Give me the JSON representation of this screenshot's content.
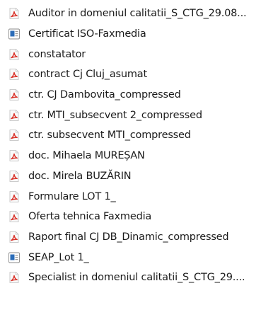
{
  "colors": {
    "pdf_icon": "#d9342b",
    "doc_icon": "#2b6cb8",
    "text": "#1b1b1b"
  },
  "files": [
    {
      "name": "Auditor in domeniul calitatii_S_CTG_29.08...",
      "icon": "pdf-icon"
    },
    {
      "name": "Certificat ISO-Faxmedia",
      "icon": "document-icon"
    },
    {
      "name": "constatator",
      "icon": "pdf-icon"
    },
    {
      "name": "contract Cj Cluj_asumat",
      "icon": "pdf-icon"
    },
    {
      "name": "ctr. CJ Dambovita_compressed",
      "icon": "pdf-icon"
    },
    {
      "name": "ctr. MTI_subsecvent 2_compressed",
      "icon": "pdf-icon"
    },
    {
      "name": "ctr. subsecvent MTI_compressed",
      "icon": "pdf-icon"
    },
    {
      "name": "doc. Mihaela MUREȘAN",
      "icon": "pdf-icon"
    },
    {
      "name": "doc. Mirela BUZĂRIN",
      "icon": "pdf-icon"
    },
    {
      "name": "Formulare LOT 1_",
      "icon": "pdf-icon"
    },
    {
      "name": "Oferta tehnica Faxmedia",
      "icon": "pdf-icon"
    },
    {
      "name": "Raport final CJ DB_Dinamic_compressed",
      "icon": "pdf-icon"
    },
    {
      "name": "SEAP_Lot 1_",
      "icon": "document-icon"
    },
    {
      "name": "Specialist in domeniul calitatii_S_CTG_29....",
      "icon": "pdf-icon"
    }
  ]
}
